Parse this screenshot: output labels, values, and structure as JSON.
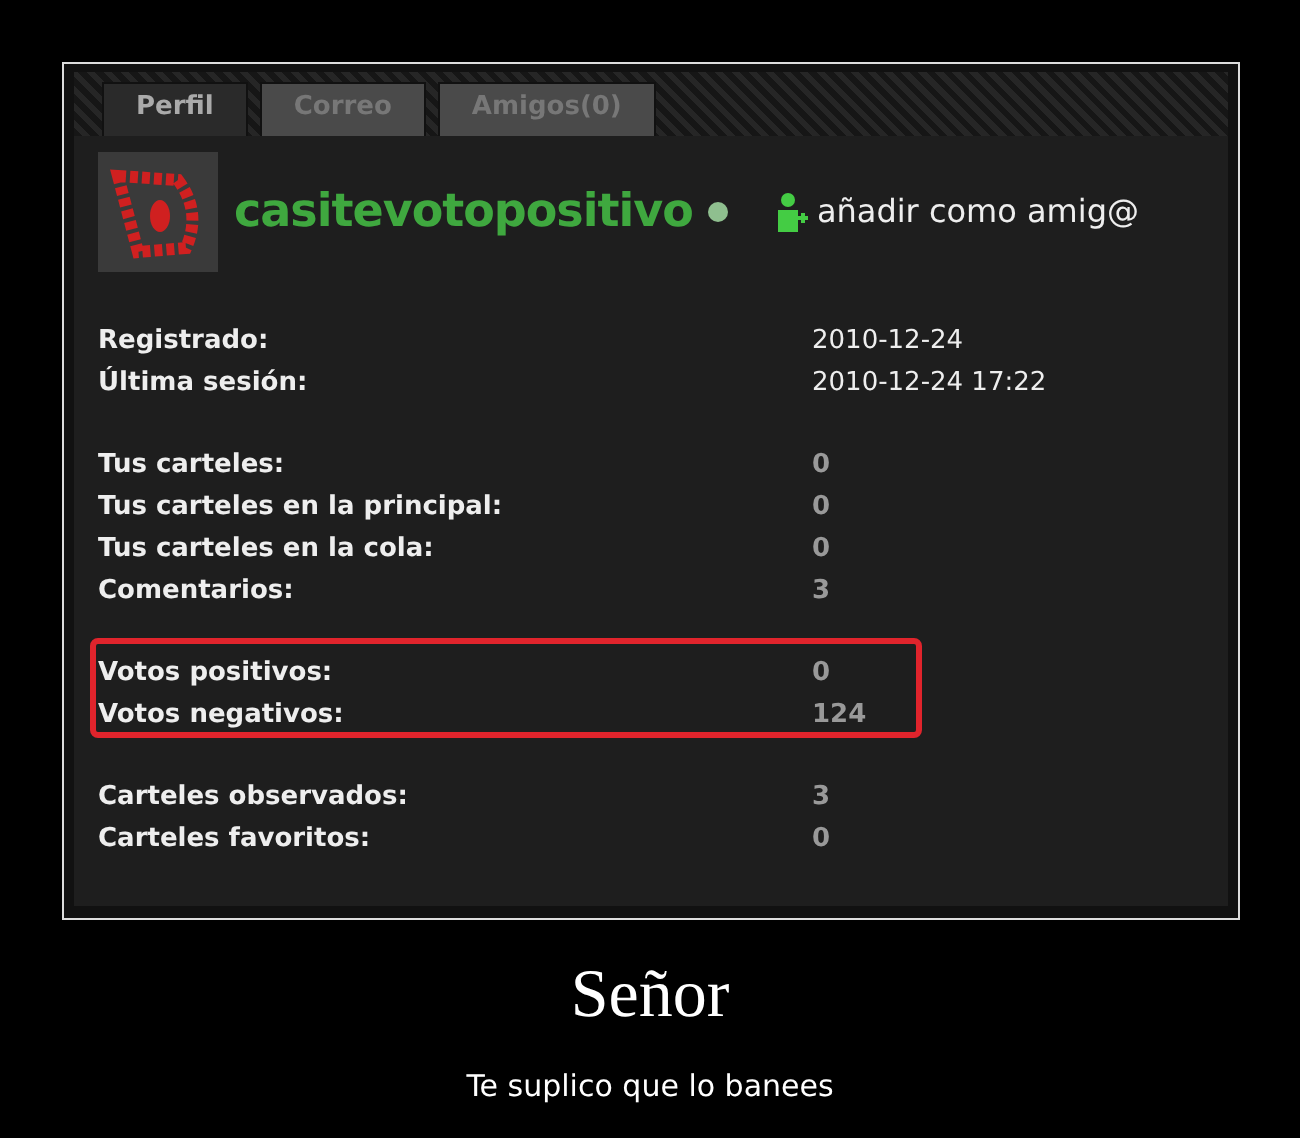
{
  "tabs": [
    {
      "label": "Perfil",
      "selected": true
    },
    {
      "label": "Correo",
      "selected": false
    },
    {
      "label": "Amigos(0)",
      "selected": false
    }
  ],
  "profile": {
    "username": "casitevotopositivo",
    "online": true,
    "add_friend": "añadir como amig@"
  },
  "stat_groups": [
    {
      "kind": "dates",
      "circled": false,
      "rows": [
        {
          "label": "Registrado:",
          "value": "2010-12-24"
        },
        {
          "label": "Última sesión:",
          "value": "2010-12-24 17:22"
        }
      ]
    },
    {
      "kind": "counts",
      "circled": false,
      "rows": [
        {
          "label": "Tus carteles:",
          "value": "0"
        },
        {
          "label": "Tus carteles en la principal:",
          "value": "0"
        },
        {
          "label": "Tus carteles en la cola:",
          "value": "0"
        },
        {
          "label": "Comentarios:",
          "value": "3"
        }
      ]
    },
    {
      "kind": "counts",
      "circled": true,
      "rows": [
        {
          "label": "Votos positivos:",
          "value": "0"
        },
        {
          "label": "Votos negativos:",
          "value": "124"
        }
      ]
    },
    {
      "kind": "counts",
      "circled": false,
      "rows": [
        {
          "label": "Carteles observados:",
          "value": "3"
        },
        {
          "label": "Carteles favoritos:",
          "value": "0"
        }
      ]
    }
  ],
  "poster": {
    "title": "Señor",
    "caption": "Te suplico que lo banees"
  }
}
